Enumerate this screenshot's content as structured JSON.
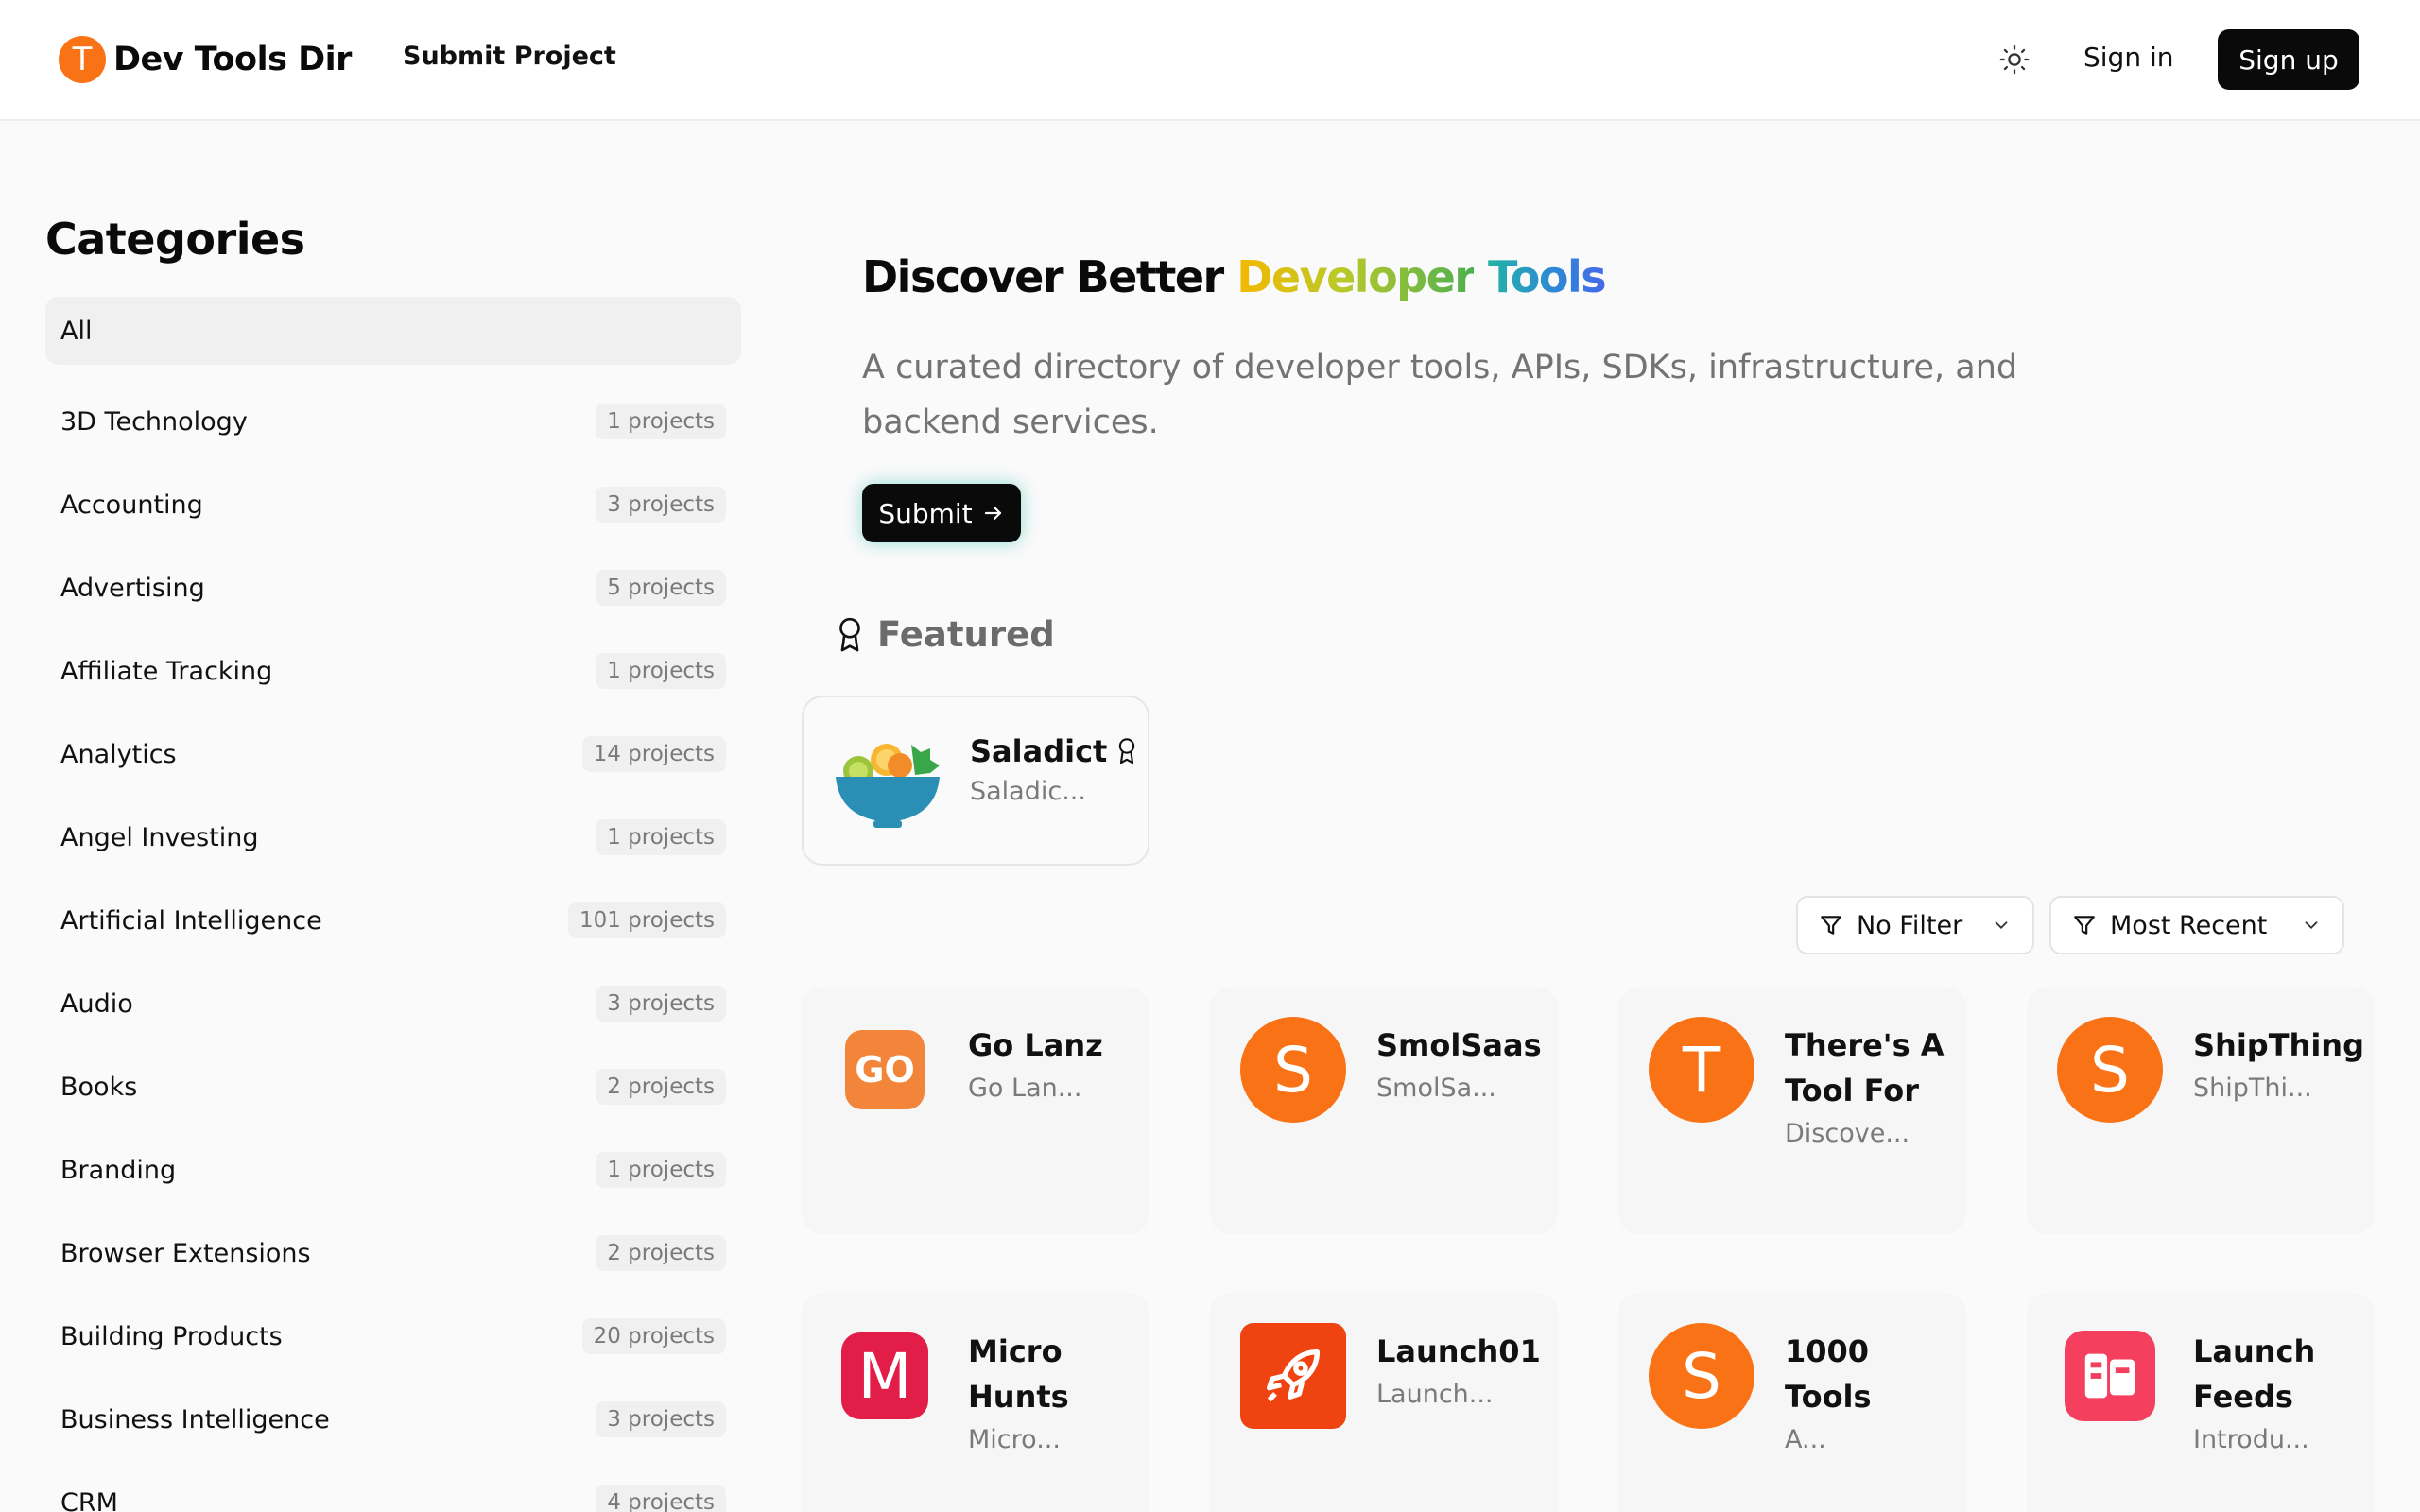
{
  "header": {
    "brand_letter": "T",
    "brand_name": "Dev Tools Dir",
    "nav_submit": "Submit Project",
    "sign_in": "Sign in",
    "sign_up": "Sign up",
    "theme_icon": "sun-icon"
  },
  "sidebar": {
    "title": "Categories",
    "items": [
      {
        "label": "All",
        "count": ""
      },
      {
        "label": "3D Technology",
        "count": "1 projects"
      },
      {
        "label": "Accounting",
        "count": "3 projects"
      },
      {
        "label": "Advertising",
        "count": "5 projects"
      },
      {
        "label": "Affiliate Tracking",
        "count": "1 projects"
      },
      {
        "label": "Analytics",
        "count": "14 projects"
      },
      {
        "label": "Angel Investing",
        "count": "1 projects"
      },
      {
        "label": "Artificial Intelligence",
        "count": "101 projects"
      },
      {
        "label": "Audio",
        "count": "3 projects"
      },
      {
        "label": "Books",
        "count": "2 projects"
      },
      {
        "label": "Branding",
        "count": "1 projects"
      },
      {
        "label": "Browser Extensions",
        "count": "2 projects"
      },
      {
        "label": "Building Products",
        "count": "20 projects"
      },
      {
        "label": "Business Intelligence",
        "count": "3 projects"
      },
      {
        "label": "CRM",
        "count": "4 projects"
      }
    ]
  },
  "hero": {
    "title_plain": "Discover Better ",
    "title_word1": "Developer",
    "title_word2": "Tools",
    "description": "A curated directory of developer tools, APIs, SDKs, infrastructure, and backend services.",
    "submit_label": "Submit"
  },
  "featured": {
    "label": "Featured",
    "item": {
      "name": "Saladict",
      "desc": "Saladic..."
    }
  },
  "filters": {
    "filter_label": "No Filter",
    "sort_label": "Most Recent"
  },
  "projects": [
    {
      "name": "Go Lanz",
      "desc": "Go Lan...",
      "logo_text": "GO",
      "color": "#f97316"
    },
    {
      "name": "SmolSaas",
      "desc": "SmolSa...",
      "logo_text": "S",
      "color": "#f97316"
    },
    {
      "name": "There's A Tool For",
      "desc": "Discove...",
      "logo_text": "T",
      "color": "#f97316"
    },
    {
      "name": "ShipThing",
      "desc": "ShipThi...",
      "logo_text": "S",
      "color": "#f97316"
    },
    {
      "name": "Micro Hunts",
      "desc": "Micro...",
      "logo_text": "M",
      "color": "#e11d48"
    },
    {
      "name": "Launch01",
      "desc": "Launch...",
      "logo_text": "",
      "color": "#ef4411"
    },
    {
      "name": "1000 Tools",
      "desc": "A...",
      "logo_text": "S",
      "color": "#f97316"
    },
    {
      "name": "Launch Feeds",
      "desc": "Introdu...",
      "logo_text": "",
      "color": "#f43f5e"
    }
  ],
  "colors": {
    "accent": "#f97316",
    "dark": "#0a0a0a",
    "muted": "#737373"
  }
}
